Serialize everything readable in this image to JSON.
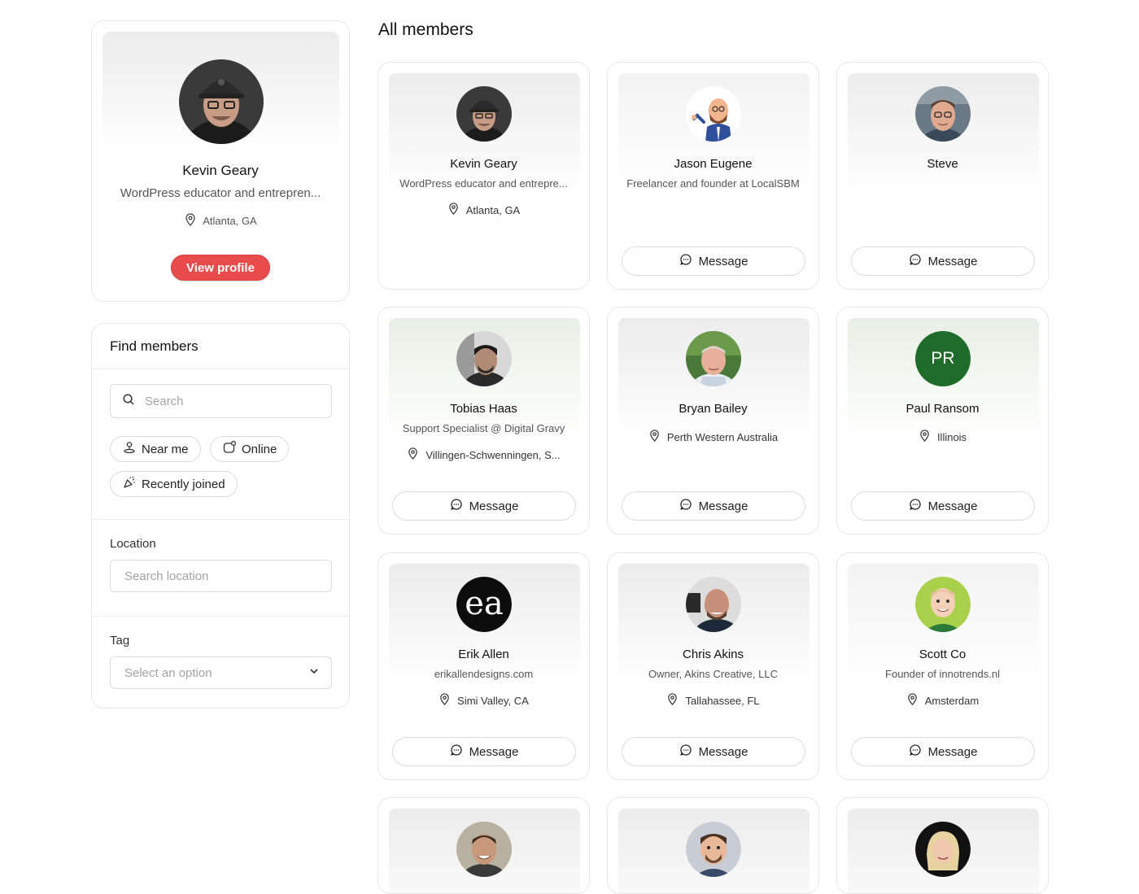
{
  "profile": {
    "name": "Kevin Geary",
    "tagline": "WordPress educator and entrepren...",
    "location": "Atlanta, GA",
    "view_profile_label": "View profile"
  },
  "filters": {
    "title": "Find members",
    "search_placeholder": "Search",
    "chips": {
      "near_me": "Near me",
      "online": "Online",
      "recently_joined": "Recently joined"
    },
    "location_label": "Location",
    "location_placeholder": "Search location",
    "tag_label": "Tag",
    "tag_placeholder": "Select an option"
  },
  "main": {
    "title": "All members",
    "message_label": "Message"
  },
  "members": [
    {
      "name": "Kevin Geary",
      "tagline": "WordPress educator and entrepre...",
      "location": "Atlanta, GA"
    },
    {
      "name": "Jason Eugene",
      "tagline": "Freelancer and founder at LocalSBM",
      "location": ""
    },
    {
      "name": "Steve",
      "tagline": "",
      "location": ""
    },
    {
      "name": "Tobias Haas",
      "tagline": "Support Specialist @ Digital Gravy",
      "location": "Villingen-Schwenningen, S..."
    },
    {
      "name": "Bryan Bailey",
      "tagline": "",
      "location": "Perth Western Australia"
    },
    {
      "name": "Paul Ransom",
      "tagline": "",
      "location": "Illinois",
      "initials": "PR"
    },
    {
      "name": "Erik Allen",
      "tagline": "erikallendesigns.com",
      "location": "Simi Valley, CA",
      "logo_text": "ea"
    },
    {
      "name": "Chris Akins",
      "tagline": "Owner, Akins Creative, LLC",
      "location": "Tallahassee, FL"
    },
    {
      "name": "Scott Co",
      "tagline": "Founder of innotrends.nl",
      "location": "Amsterdam"
    }
  ],
  "colors": {
    "accent": "#e84b4b",
    "initials_avatar": "#1e6b2a"
  },
  "icons": [
    "search-icon",
    "location-pin-icon",
    "person-pin-icon",
    "online-icon",
    "party-icon",
    "chevron-down-icon",
    "message-icon"
  ]
}
